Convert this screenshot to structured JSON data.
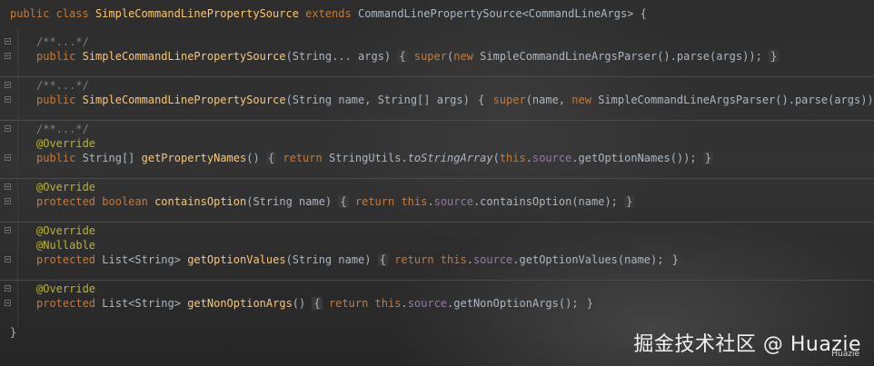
{
  "code": {
    "class_decl": {
      "public": "public",
      "class": "class",
      "name": "SimpleCommandLinePropertySource",
      "extends": "extends",
      "parent": "CommandLinePropertySource<CommandLineArgs>",
      "brace": " {"
    },
    "folded_comment": "/**...*/",
    "ctor1": {
      "public": "public",
      "name": "SimpleCommandLinePropertySource",
      "params": "(String... args)",
      "open": "{",
      "super": "super",
      "paren": "(",
      "new": "new",
      "call": "SimpleCommandLineArgsParser().parse(args));",
      "close": "}"
    },
    "ctor2": {
      "public": "public",
      "name": "SimpleCommandLinePropertySource",
      "params": "(String name, String[] args)",
      "open": "{",
      "super": "super",
      "pre": "(name,",
      "new": "new",
      "call": "SimpleCommandLineArgsParser().parse(args));",
      "close": "}"
    },
    "m1": {
      "annotation": "@Override",
      "public": "public",
      "ret": "String[]",
      "name": "getPropertyNames",
      "params": "()",
      "open": "{",
      "return": "return",
      "callee": "StringUtils.",
      "static_call": "toStringArray",
      "paren": "(",
      "this": "this",
      "field": "source",
      "rest": ".getOptionNames());",
      "close": "}"
    },
    "m2": {
      "annotation": "@Override",
      "protected": "protected",
      "ret": "boolean",
      "name": "containsOption",
      "params": "(String name)",
      "open": "{",
      "return": "return",
      "this": "this",
      "field": "source",
      "rest": ".containsOption(name);",
      "close": "}"
    },
    "m3": {
      "annotation1": "@Override",
      "annotation2": "@Nullable",
      "protected": "protected",
      "ret": "List<String>",
      "name": "getOptionValues",
      "params": "(String name)",
      "open": "{",
      "return": "return",
      "this": "this",
      "field": "source",
      "rest": ".getOptionValues(name);",
      "close": "}"
    },
    "m4": {
      "annotation": "@Override",
      "protected": "protected",
      "ret": "List<String>",
      "name": "getNonOptionArgs",
      "params": "()",
      "open": "{",
      "return": "return",
      "this": "this",
      "field": "source",
      "rest": ".getNonOptionArgs();",
      "close": "}"
    },
    "class_close": "}"
  },
  "watermark": {
    "main": "掘金技术社区 @ Huazie",
    "sub": "Huazie"
  },
  "colors": {
    "keyword": "#cc7832",
    "function": "#ffc66d",
    "field": "#9876aa",
    "annotation": "#bbb529",
    "comment": "#808080",
    "text": "#a9b7c6",
    "background": "#2b2b2b"
  }
}
